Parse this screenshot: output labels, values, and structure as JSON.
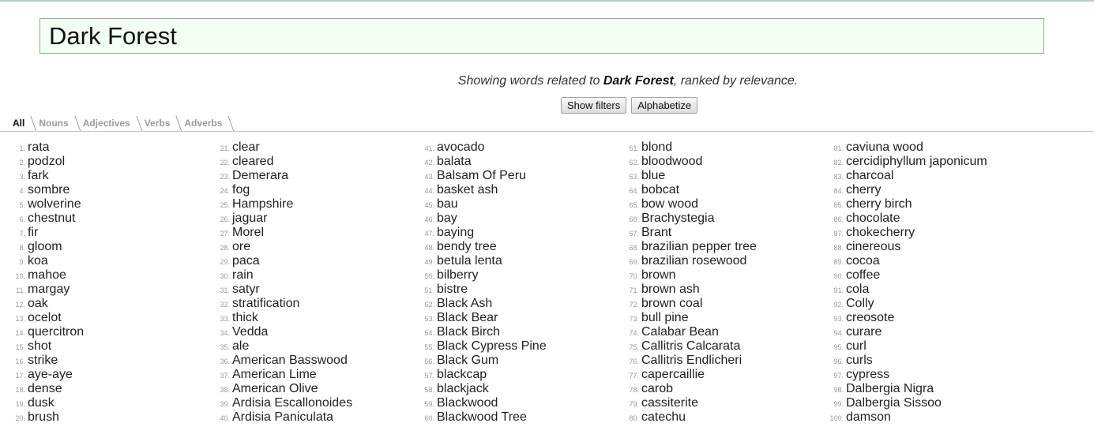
{
  "search": {
    "value": "Dark Forest"
  },
  "summary": {
    "prefix": "Showing words related to ",
    "term": "Dark Forest",
    "suffix": ", ranked by relevance."
  },
  "buttons": {
    "show_filters": "Show filters",
    "alphabetize": "Alphabetize"
  },
  "tabs": [
    {
      "label": "All",
      "active": true
    },
    {
      "label": "Nouns",
      "active": false
    },
    {
      "label": "Adjectives",
      "active": false
    },
    {
      "label": "Verbs",
      "active": false
    },
    {
      "label": "Adverbs",
      "active": false
    }
  ],
  "columns": [
    [
      {
        "n": "1.",
        "w": "rata"
      },
      {
        "n": "2.",
        "w": "podzol"
      },
      {
        "n": "3.",
        "w": "fark"
      },
      {
        "n": "4.",
        "w": "sombre"
      },
      {
        "n": "5.",
        "w": "wolverine"
      },
      {
        "n": "6.",
        "w": "chestnut"
      },
      {
        "n": "7.",
        "w": "fir"
      },
      {
        "n": "8.",
        "w": "gloom"
      },
      {
        "n": "9.",
        "w": "koa"
      },
      {
        "n": "10.",
        "w": "mahoe"
      },
      {
        "n": "11.",
        "w": "margay"
      },
      {
        "n": "12.",
        "w": "oak"
      },
      {
        "n": "13.",
        "w": "ocelot"
      },
      {
        "n": "14.",
        "w": "quercitron"
      },
      {
        "n": "15.",
        "w": "shot"
      },
      {
        "n": "16.",
        "w": "strike"
      },
      {
        "n": "17.",
        "w": "aye-aye"
      },
      {
        "n": "18.",
        "w": "dense"
      },
      {
        "n": "19.",
        "w": "dusk"
      },
      {
        "n": "20.",
        "w": "brush"
      }
    ],
    [
      {
        "n": "21.",
        "w": "clear"
      },
      {
        "n": "22.",
        "w": "cleared"
      },
      {
        "n": "23.",
        "w": "Demerara"
      },
      {
        "n": "24.",
        "w": "fog"
      },
      {
        "n": "25.",
        "w": "Hampshire"
      },
      {
        "n": "26.",
        "w": "jaguar"
      },
      {
        "n": "27.",
        "w": "Morel"
      },
      {
        "n": "28.",
        "w": "ore"
      },
      {
        "n": "29.",
        "w": "paca"
      },
      {
        "n": "30.",
        "w": "rain"
      },
      {
        "n": "31.",
        "w": "satyr"
      },
      {
        "n": "32.",
        "w": "stratification"
      },
      {
        "n": "33.",
        "w": "thick"
      },
      {
        "n": "34.",
        "w": "Vedda"
      },
      {
        "n": "35.",
        "w": "ale"
      },
      {
        "n": "36.",
        "w": "American Basswood"
      },
      {
        "n": "37.",
        "w": "American Lime"
      },
      {
        "n": "38.",
        "w": "American Olive"
      },
      {
        "n": "39.",
        "w": "Ardisia Escallonoides"
      },
      {
        "n": "40.",
        "w": "Ardisia Paniculata"
      }
    ],
    [
      {
        "n": "41.",
        "w": "avocado"
      },
      {
        "n": "42.",
        "w": "balata"
      },
      {
        "n": "43.",
        "w": "Balsam Of Peru"
      },
      {
        "n": "44.",
        "w": "basket ash"
      },
      {
        "n": "45.",
        "w": "bau"
      },
      {
        "n": "46.",
        "w": "bay"
      },
      {
        "n": "47.",
        "w": "baying"
      },
      {
        "n": "48.",
        "w": "bendy tree"
      },
      {
        "n": "49.",
        "w": "betula lenta"
      },
      {
        "n": "50.",
        "w": "bilberry"
      },
      {
        "n": "51.",
        "w": "bistre"
      },
      {
        "n": "52.",
        "w": "Black Ash"
      },
      {
        "n": "53.",
        "w": "Black Bear"
      },
      {
        "n": "54.",
        "w": "Black Birch"
      },
      {
        "n": "55.",
        "w": "Black Cypress Pine"
      },
      {
        "n": "56.",
        "w": "Black Gum"
      },
      {
        "n": "57.",
        "w": "blackcap"
      },
      {
        "n": "58.",
        "w": "blackjack"
      },
      {
        "n": "59.",
        "w": "Blackwood"
      },
      {
        "n": "60.",
        "w": "Blackwood Tree"
      }
    ],
    [
      {
        "n": "61.",
        "w": "blond"
      },
      {
        "n": "62.",
        "w": "bloodwood"
      },
      {
        "n": "63.",
        "w": "blue"
      },
      {
        "n": "64.",
        "w": "bobcat"
      },
      {
        "n": "65.",
        "w": "bow wood"
      },
      {
        "n": "66.",
        "w": "Brachystegia"
      },
      {
        "n": "67.",
        "w": "Brant"
      },
      {
        "n": "68.",
        "w": "brazilian pepper tree"
      },
      {
        "n": "69.",
        "w": "brazilian rosewood"
      },
      {
        "n": "70.",
        "w": "brown"
      },
      {
        "n": "71.",
        "w": "brown ash"
      },
      {
        "n": "72.",
        "w": "brown coal"
      },
      {
        "n": "73.",
        "w": "bull pine"
      },
      {
        "n": "74.",
        "w": "Calabar Bean"
      },
      {
        "n": "75.",
        "w": "Callitris Calcarata"
      },
      {
        "n": "76.",
        "w": "Callitris Endlicheri"
      },
      {
        "n": "77.",
        "w": "capercaillie"
      },
      {
        "n": "78.",
        "w": "carob"
      },
      {
        "n": "79.",
        "w": "cassiterite"
      },
      {
        "n": "80.",
        "w": "catechu"
      }
    ],
    [
      {
        "n": "81.",
        "w": "caviuna wood"
      },
      {
        "n": "82.",
        "w": "cercidiphyllum japonicum"
      },
      {
        "n": "83.",
        "w": "charcoal"
      },
      {
        "n": "84.",
        "w": "cherry"
      },
      {
        "n": "85.",
        "w": "cherry birch"
      },
      {
        "n": "86.",
        "w": "chocolate"
      },
      {
        "n": "87.",
        "w": "chokecherry"
      },
      {
        "n": "88.",
        "w": "cinereous"
      },
      {
        "n": "89.",
        "w": "cocoa"
      },
      {
        "n": "90.",
        "w": "coffee"
      },
      {
        "n": "91.",
        "w": "cola"
      },
      {
        "n": "92.",
        "w": "Colly"
      },
      {
        "n": "93.",
        "w": "creosote"
      },
      {
        "n": "94.",
        "w": "curare"
      },
      {
        "n": "95.",
        "w": "curl"
      },
      {
        "n": "96.",
        "w": "curls"
      },
      {
        "n": "97.",
        "w": "cypress"
      },
      {
        "n": "98.",
        "w": "Dalbergia Nigra"
      },
      {
        "n": "99.",
        "w": "Dalbergia Sissoo"
      },
      {
        "n": "100.",
        "w": "damson"
      }
    ]
  ]
}
